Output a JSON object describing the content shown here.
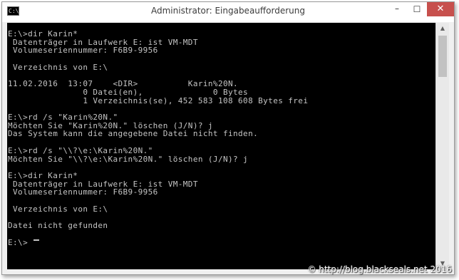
{
  "window": {
    "title": "Administrator: Eingabeaufforderung",
    "icon_label": "C:\\",
    "buttons": {
      "minimize": "–",
      "maximize": "☐",
      "close": "✕"
    }
  },
  "console": {
    "lines": [
      "E:\\>dir Karin*",
      " Datenträger in Laufwerk E: ist VM-MDT",
      " Volumeseriennummer: F6B9-9956",
      "",
      " Verzeichnis von E:\\",
      "",
      "11.02.2016  13:07    <DIR>          Karin%20N.",
      "               0 Datei(en),              0 Bytes",
      "               1 Verzeichnis(se), 452 583 108 608 Bytes frei",
      "",
      "E:\\>rd /s \"Karin%20N.\"",
      "Möchten Sie \"Karin%20N.\" löschen (J/N)? j",
      "Das System kann die angegebene Datei nicht finden.",
      "",
      "E:\\>rd /s \"\\\\?\\e:\\Karin%20N.\"",
      "Möchten Sie \"\\\\?\\e:\\Karin%20N.\" löschen (J/N)? j",
      "",
      "E:\\>dir Karin*",
      " Datenträger in Laufwerk E: ist VM-MDT",
      " Volumeseriennummer: F6B9-9956",
      "",
      " Verzeichnis von E:\\",
      "",
      "Datei nicht gefunden",
      "",
      "E:\\>"
    ]
  },
  "scrollbar": {
    "up_arrow": "▲",
    "down_arrow": "▼"
  },
  "watermark": "© http://blog.blackseals.net 2016"
}
